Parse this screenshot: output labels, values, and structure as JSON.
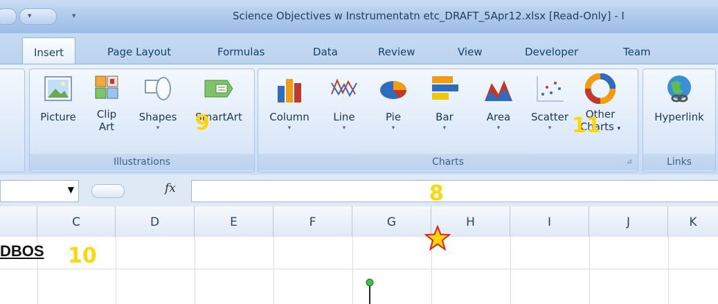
{
  "window": {
    "title": "Science Objectives w Instrumentatn etc_DRAFT_5Apr12.xlsx  [Read-Only]  - I"
  },
  "tabs": [
    {
      "label": "Insert",
      "active": true
    },
    {
      "label": "Page Layout"
    },
    {
      "label": "Formulas"
    },
    {
      "label": "Data"
    },
    {
      "label": "Review"
    },
    {
      "label": "View"
    },
    {
      "label": "Developer"
    },
    {
      "label": "Team"
    }
  ],
  "ribbon": {
    "illustrations": {
      "label": "Illustrations",
      "commands": [
        {
          "label": "Picture",
          "icon": "picture-icon"
        },
        {
          "label": "Clip Art",
          "line1": "Clip",
          "line2": "Art",
          "icon": "clip-art-icon"
        },
        {
          "label": "Shapes",
          "icon": "shapes-icon"
        },
        {
          "label": "SmartArt",
          "icon": "smartart-icon"
        }
      ]
    },
    "charts": {
      "label": "Charts",
      "commands": [
        {
          "label": "Column",
          "icon": "column-chart-icon"
        },
        {
          "label": "Line",
          "icon": "line-chart-icon"
        },
        {
          "label": "Pie",
          "icon": "pie-chart-icon"
        },
        {
          "label": "Bar",
          "icon": "bar-chart-icon"
        },
        {
          "label": "Area",
          "icon": "area-chart-icon"
        },
        {
          "label": "Scatter",
          "icon": "scatter-chart-icon"
        },
        {
          "label": "Other Charts",
          "line1": "Other",
          "line2": "Charts",
          "icon": "other-charts-icon"
        }
      ]
    },
    "links": {
      "label": "Links",
      "commands": [
        {
          "label": "Hyperlink",
          "icon": "hyperlink-icon"
        }
      ]
    }
  },
  "formula_bar": {
    "fx_label": "fx",
    "value": ""
  },
  "columns": [
    "C",
    "D",
    "E",
    "F",
    "G",
    "H",
    "I",
    "J",
    "K"
  ],
  "cells": {
    "heading": "DBOS"
  },
  "annotations": {
    "marker_8": "8",
    "marker_9": "9",
    "marker_10": "10",
    "marker_11": "11",
    "marker_color": "#ffd60a",
    "star_icon": "star-icon"
  }
}
